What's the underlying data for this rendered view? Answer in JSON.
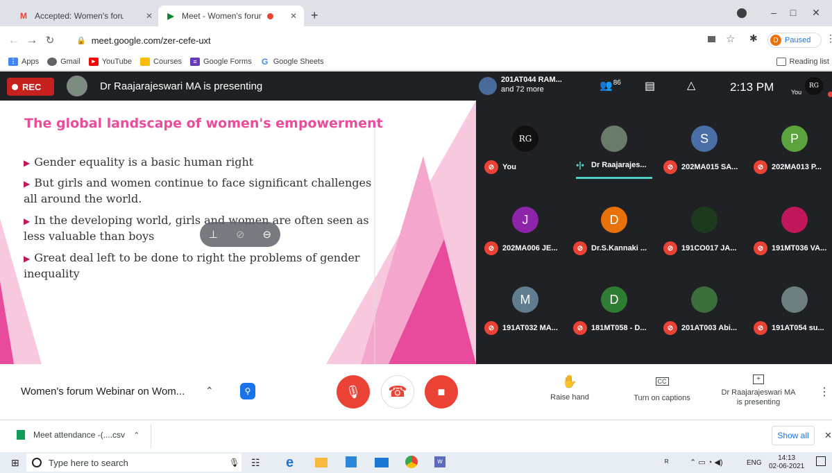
{
  "tabs": [
    {
      "title": "Accepted: Women's forum Webi",
      "favicon": "M"
    },
    {
      "title": "Meet - Women's forum Web",
      "favicon": "▶"
    }
  ],
  "window": {
    "new_tab": "+",
    "minimize": "–",
    "maximize": "□",
    "close": "✕"
  },
  "address": {
    "url": "meet.google.com/zer-cefe-uxt",
    "profile_initial": "D",
    "profile_status": "Paused"
  },
  "bookmarks": [
    "Apps",
    "Gmail",
    "YouTube",
    "Courses",
    "Google Forms",
    "Google Sheets"
  ],
  "reading_list": "Reading list",
  "meet": {
    "rec": "REC",
    "presenter_text": "Dr Raajarajeswari MA is presenting",
    "participants_preview_1": "201AT044 RAM...",
    "participants_preview_2": "and 72 more",
    "participant_count": "86",
    "time": "2:13 PM",
    "self_label": "You",
    "self_initials": "RG"
  },
  "slide": {
    "title": "The global landscape of women's empowerment",
    "bullets": [
      "Gender equality is a basic human right",
      "But girls and women continue to face significant challenges all around the world.",
      "In the developing world, girls and women are often seen as less valuable than boys",
      "Great deal left to be done to right the problems of gender inequality"
    ]
  },
  "participants": [
    {
      "name": "You",
      "initial": "RG",
      "color": "#111111"
    },
    {
      "name": "Dr Raajarajes...",
      "initial": "",
      "color": "#6b7b6a"
    },
    {
      "name": "202MA015 SA...",
      "initial": "S",
      "color": "#4a6fa5"
    },
    {
      "name": "202MA013 P...",
      "initial": "P",
      "color": "#5aa33d"
    },
    {
      "name": "202MA006 JE...",
      "initial": "J",
      "color": "#8e24aa"
    },
    {
      "name": "Dr.S.Kannaki ...",
      "initial": "D",
      "color": "#e8710a"
    },
    {
      "name": "191CO017 JA...",
      "initial": "",
      "color": "#1e3a1e"
    },
    {
      "name": "191MT036 VA...",
      "initial": "",
      "color": "#c2185b"
    },
    {
      "name": "191AT032 MA...",
      "initial": "M",
      "color": "#5f7d8e"
    },
    {
      "name": "181MT058 - D...",
      "initial": "D",
      "color": "#2e7d32"
    },
    {
      "name": "201AT003 Abi...",
      "initial": "",
      "color": "#3b6e3b"
    },
    {
      "name": "191AT054 su...",
      "initial": "",
      "color": "#6d7f80"
    }
  ],
  "controls": {
    "meeting_title": "Women's forum Webinar on Wom...",
    "raise_hand": "Raise hand",
    "captions": "Turn on captions",
    "presenting_1": "Dr Raajarajeswari MA",
    "presenting_2": "is presenting"
  },
  "downloads": {
    "file": "Meet attendance -(....csv",
    "show_all": "Show all"
  },
  "taskbar": {
    "search_placeholder": "Type here to search",
    "lang": "ENG",
    "time": "14:13",
    "date": "02-06-2021"
  },
  "colors": {
    "rec": "#c5221f",
    "red_ctrl": "#ea4335",
    "accent_pink": "#e84c9b",
    "meet_bg": "#202124"
  }
}
